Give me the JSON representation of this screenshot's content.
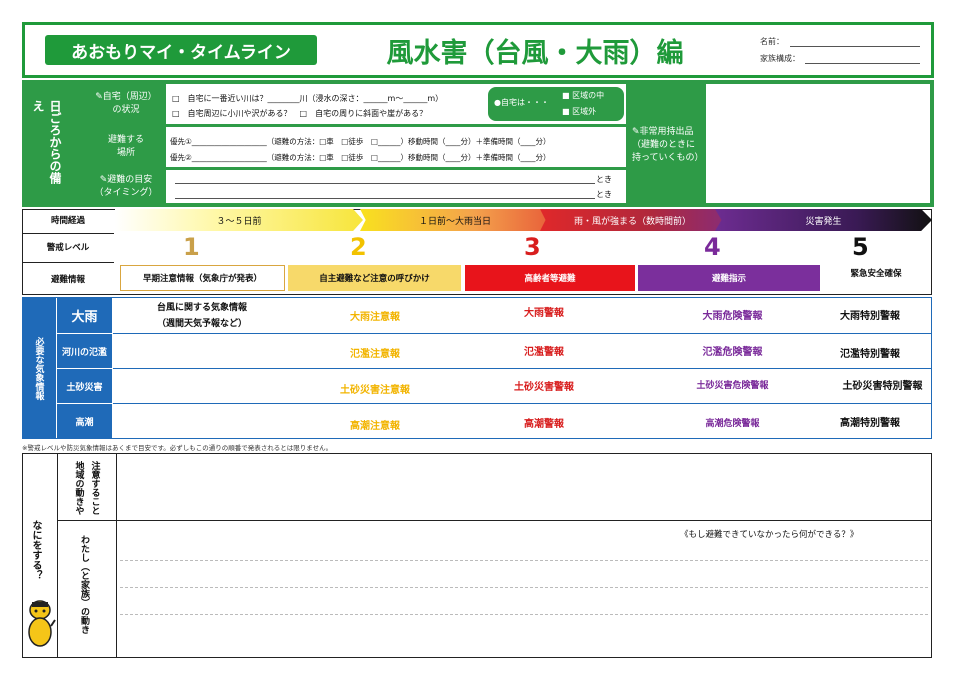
{
  "header": {
    "app_title": "あおもりマイ・タイムライン",
    "main_title": "風水害（台風・大雨）編",
    "name_label": "名前：",
    "family_label": "家族構成："
  },
  "prep": {
    "section_label": "日ごろからの備え",
    "home_label_1": "✎自宅（周辺）",
    "home_label_2": "の状況",
    "home_line1": "□　自宅に一番近い川は？________川（浸水の深さ：______m～______m）",
    "home_line2": "□　自宅周辺に小川や沢がある？　□　自宅の周りに斜面や崖がある？",
    "home_badge": "●自宅は・・・",
    "home_opt1": "区域の中",
    "home_opt2": "区域外",
    "evac_label_1": "避難する",
    "evac_label_2": "場所",
    "evac_line1": "優先①____________________（避難の方法：□車　□徒歩　□______）移動時間（____分）＋準備時間（____分）",
    "evac_line2": "優先②____________________（避難の方法：□車　□徒歩　□______）移動時間（____分）＋準備時間（____分）",
    "timing_label_1": "✎避難の目安",
    "timing_label_2": "（タイミング）",
    "toki": "とき",
    "emergency_label_1": "✎非常用持出品",
    "emergency_label_2": "（避難のときに",
    "emergency_label_3": "持っていくもの）"
  },
  "timeline": {
    "row_time": "時間経過",
    "row_level": "警戒レベル",
    "row_evac": "避難情報",
    "phases": [
      "３～５日前",
      "１日前～大雨当日",
      "雨・風が強まる（数時間前）",
      "災害発生"
    ],
    "levels": [
      "1",
      "2",
      "3",
      "4",
      "5"
    ],
    "evac_info": [
      "早期注意情報（気象庁が発表）",
      "自主避難など注意の呼びかけ",
      "高齢者等避難",
      "避難指示",
      "緊急安全確保"
    ]
  },
  "weather": {
    "section_label": "必要な気象情報",
    "rows": [
      {
        "label": "大雨",
        "cells": [
          "台風に関する気象情報",
          "大雨注意報",
          "大雨警報",
          "大雨危険警報",
          "大雨特別警報"
        ],
        "extra": "（週間天気予報など）"
      },
      {
        "label": "河川の氾濫",
        "cells": [
          "",
          "氾濫注意報",
          "氾濫警報",
          "氾濫危険警報",
          "氾濫特別警報"
        ]
      },
      {
        "label": "土砂災害",
        "cells": [
          "",
          "土砂災害注意報",
          "土砂災害警報",
          "土砂災害危険警報",
          "土砂災害特別警報"
        ]
      },
      {
        "label": "高潮",
        "cells": [
          "",
          "高潮注意報",
          "高潮警報",
          "高潮危険警報",
          "高潮特別警報"
        ]
      }
    ],
    "note": "※警戒レベルや防災気象情報はあくまで目安です。必ずしもこの通りの順番で発表されるとは限りません。"
  },
  "actions": {
    "section_label": "なにをする？",
    "row1_a": "注意すること",
    "row1_b": "地域の動きや",
    "row2": "わたし（と家族）の動き",
    "hint": "《もし避難できていなかったら何ができる？》"
  },
  "colors": {
    "green": "#1f9a3a",
    "blue": "#1f6ab8",
    "level1": "#c9a04a",
    "level2": "#f2c200",
    "level3": "#d81e1e",
    "level4": "#7a2a9a",
    "level5": "#111111"
  }
}
